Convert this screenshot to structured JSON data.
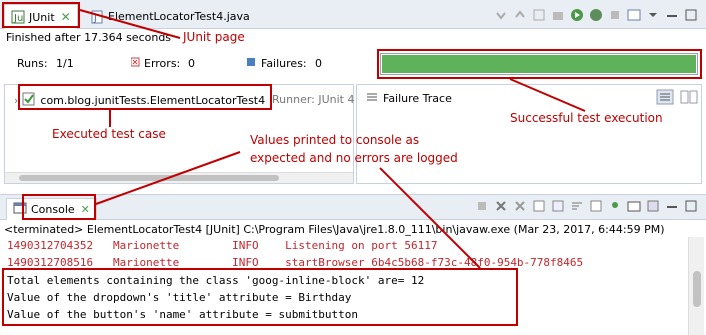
{
  "junit": {
    "tabs": [
      {
        "label": "JUnit",
        "close": "✕",
        "icon": "junit-icon"
      },
      {
        "label": "ElementLocatorTest4.java",
        "icon": "java-file-icon"
      }
    ],
    "finished": "Finished after 17.364 seconds",
    "counters": {
      "runs_label": "Runs:",
      "runs_value": "1/1",
      "errors_label": "Errors:",
      "errors_value": "0",
      "failures_label": "Failures:",
      "failures_value": "0"
    },
    "progress_fraction": 1.0,
    "progress_color": "#5fb25a",
    "test_case": "com.blog.junitTests.ElementLocatorTest4",
    "runner": "Runner: JUnit 4",
    "failure_trace_label": "Failure Trace"
  },
  "console": {
    "tab_label": "Console",
    "close": "✕",
    "terminated": "<terminated> ElementLocatorTest4 [JUnit] C:\\Program Files\\Java\\jre1.8.0_111\\bin\\javaw.exe (Mar 23, 2017, 6:44:59 PM)",
    "log_lines": [
      {
        "text": "1490312704352   Marionette        INFO    Listening on port 56117",
        "color": "red"
      },
      {
        "text": "1490312708516   Marionette        INFO    startBrowser 6b4c5b68-f73c-48f0-954b-778f8465",
        "color": "red"
      }
    ],
    "output_lines": [
      "Total elements containing the class 'goog-inline-block' are= 12",
      "Value of the dropdown's 'title' attribute = Birthday",
      "Value of the button's 'name' attribute = submitbutton"
    ]
  },
  "annotations": {
    "junit_page": "JUnit page",
    "executed_test_case": "Executed test case",
    "successful_execution": "Successful test execution",
    "console_note_1": "Values printed to console as",
    "console_note_2": "expected and no errors are logged",
    "color": "#c00000"
  }
}
